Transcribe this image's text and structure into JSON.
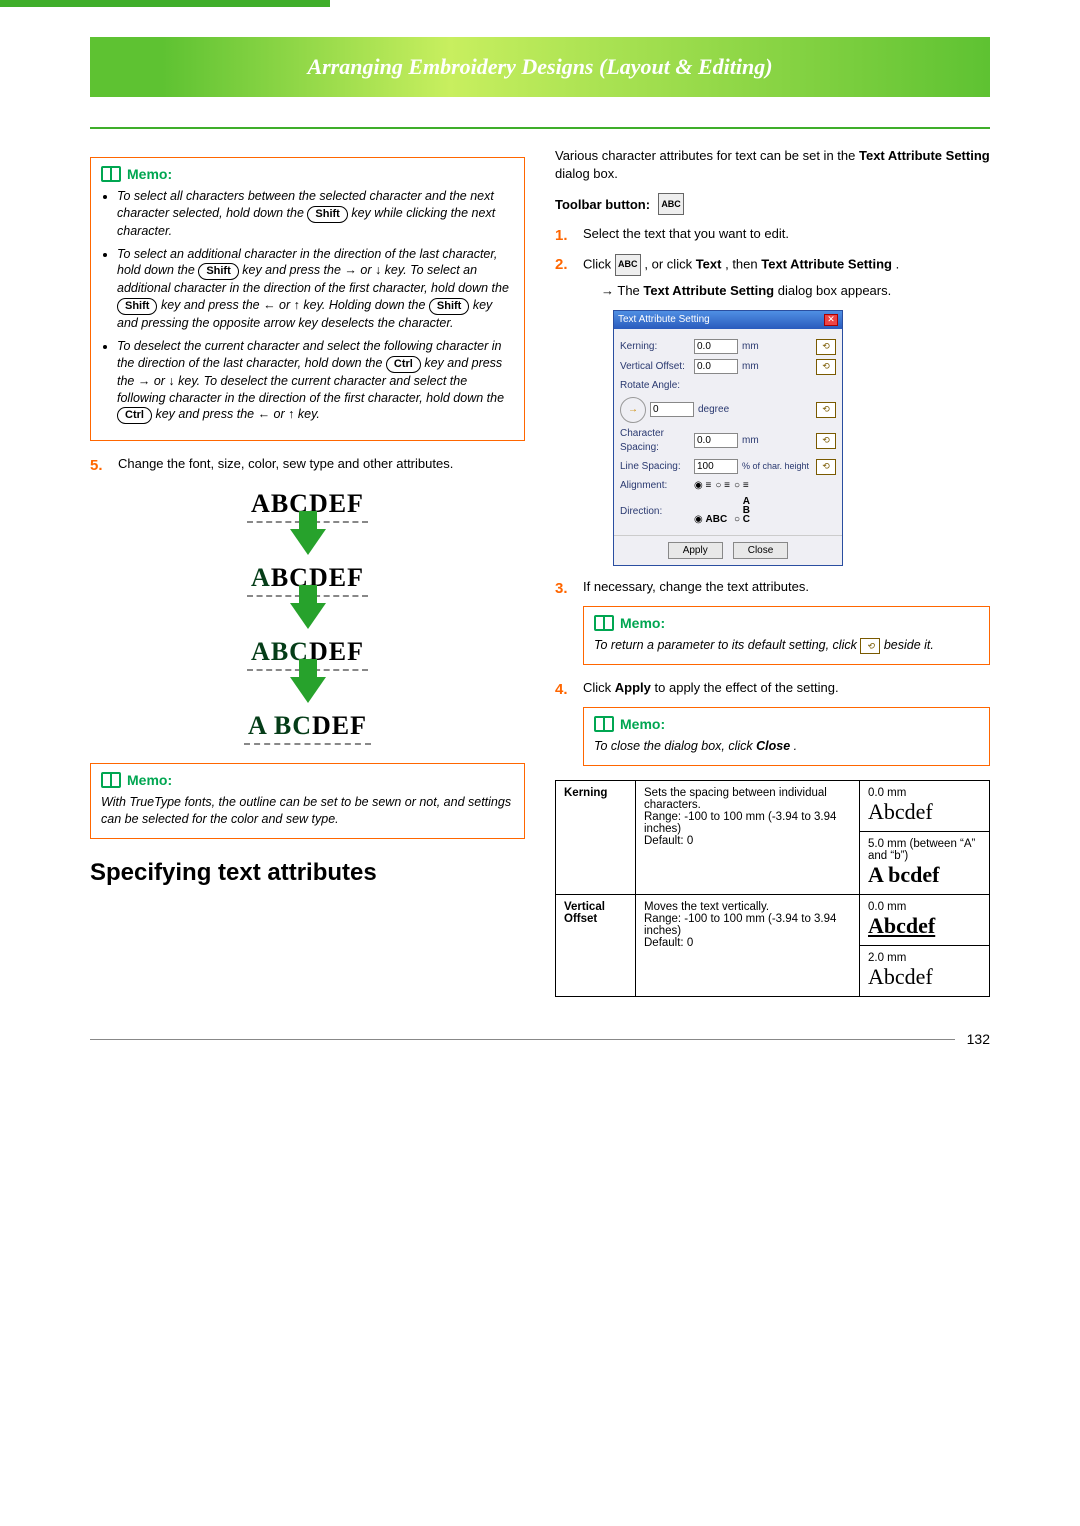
{
  "banner": {
    "title": "Arranging Embroidery Designs (Layout & Editing)"
  },
  "left": {
    "memo1": {
      "heading": "Memo:",
      "items": [
        {
          "pre": "To select all characters between the selected character and the next character selected, hold down the ",
          "key": "Shift",
          "post": " key while clicking the next character."
        },
        {
          "pre": "To select an additional character in the direction of the last character, hold down the ",
          "key": "Shift",
          "mid": " key and press the → or ↓ key. To select an additional character in the direction of the first character, hold down the ",
          "key2": "Shift",
          "mid2": " key and press the ← or ↑ key. Holding down the ",
          "key3": "Shift",
          "post": " key and pressing the opposite arrow key deselects the character."
        },
        {
          "pre": "To deselect the current character and select the following character in the direction of the last character, hold down the ",
          "key": "Ctrl",
          "mid": " key and press the → or ↓ key. To deselect the current character and select the following character in the direction of the first character, hold down the ",
          "key2": "Ctrl",
          "post": " key and press the ← or ↑ key."
        }
      ]
    },
    "step5": "Change the font, size, color, sew type and other attributes.",
    "stackWord": "ABCDEF",
    "memo2": {
      "heading": "Memo:",
      "text": "With TrueType fonts, the outline can be set to be sewn or not, and settings can be selected for the color and sew type."
    },
    "sectionTitle": "Specifying text attributes"
  },
  "right": {
    "intro": {
      "pre": "Various character attributes for text can be set in the ",
      "bold": "Text Attribute Setting",
      "post": " dialog box."
    },
    "toolbarLabel": "Toolbar button:",
    "iconLabel": "ABC",
    "steps": {
      "s1": "Select the text that you want to edit.",
      "s2": {
        "pre": "Click ",
        "mid": ", or click ",
        "b1": "Text",
        "mid2": ", then ",
        "b2": "Text Attribute Setting",
        "post": "."
      },
      "s2sub": {
        "arrow": "→",
        "pre": "The ",
        "bold": "Text Attribute Setting",
        "post": " dialog box appears."
      },
      "s3": "If necessary, change the text attributes.",
      "s4": {
        "pre": "Click ",
        "bold": "Apply",
        "post": " to apply the effect of the setting."
      }
    },
    "dlg": {
      "title": "Text Attribute Setting",
      "kerning": {
        "label": "Kerning:",
        "value": "0.0",
        "unit": "mm"
      },
      "voffset": {
        "label": "Vertical Offset:",
        "value": "0.0",
        "unit": "mm"
      },
      "rotate": {
        "label": "Rotate Angle:",
        "value": "0",
        "unit": "degree"
      },
      "cspacing": {
        "label": "Character Spacing:",
        "value": "0.0",
        "unit": "mm"
      },
      "lspacing": {
        "label": "Line Spacing:",
        "value": "100",
        "unit": "% of char. height"
      },
      "alignment": "Alignment:",
      "direction": "Direction:",
      "dirH": "ABC",
      "dirVTop": "A",
      "dirVMid": "B",
      "dirVBot": "C",
      "apply": "Apply",
      "close": "Close"
    },
    "memo3": {
      "heading": "Memo:",
      "text1": "To return a parameter to its default setting, click ",
      "text2": " beside it."
    },
    "memo4": {
      "heading": "Memo:",
      "pre": "To close the dialog box, click ",
      "bold": "Close",
      "post": "."
    },
    "table": {
      "kerning": {
        "name": "Kerning",
        "desc": "Sets the spacing between individual characters.\nRange: -100 to 100 mm (-3.94 to 3.94 inches)\nDefault: 0",
        "r1a": "0.0 mm",
        "r1b": "Abcdef",
        "r2a": "5.0 mm (between “A” and “b”)",
        "r2b": "A bcdef"
      },
      "voff": {
        "name": "Vertical Offset",
        "desc": "Moves the text vertically.\nRange: -100 to 100 mm (-3.94 to 3.94 inches)\nDefault: 0",
        "r1a": "0.0 mm",
        "r1b": "Abcdef",
        "r2a": "2.0 mm",
        "r2b": "Abcdef"
      }
    }
  },
  "pageNumber": "132"
}
